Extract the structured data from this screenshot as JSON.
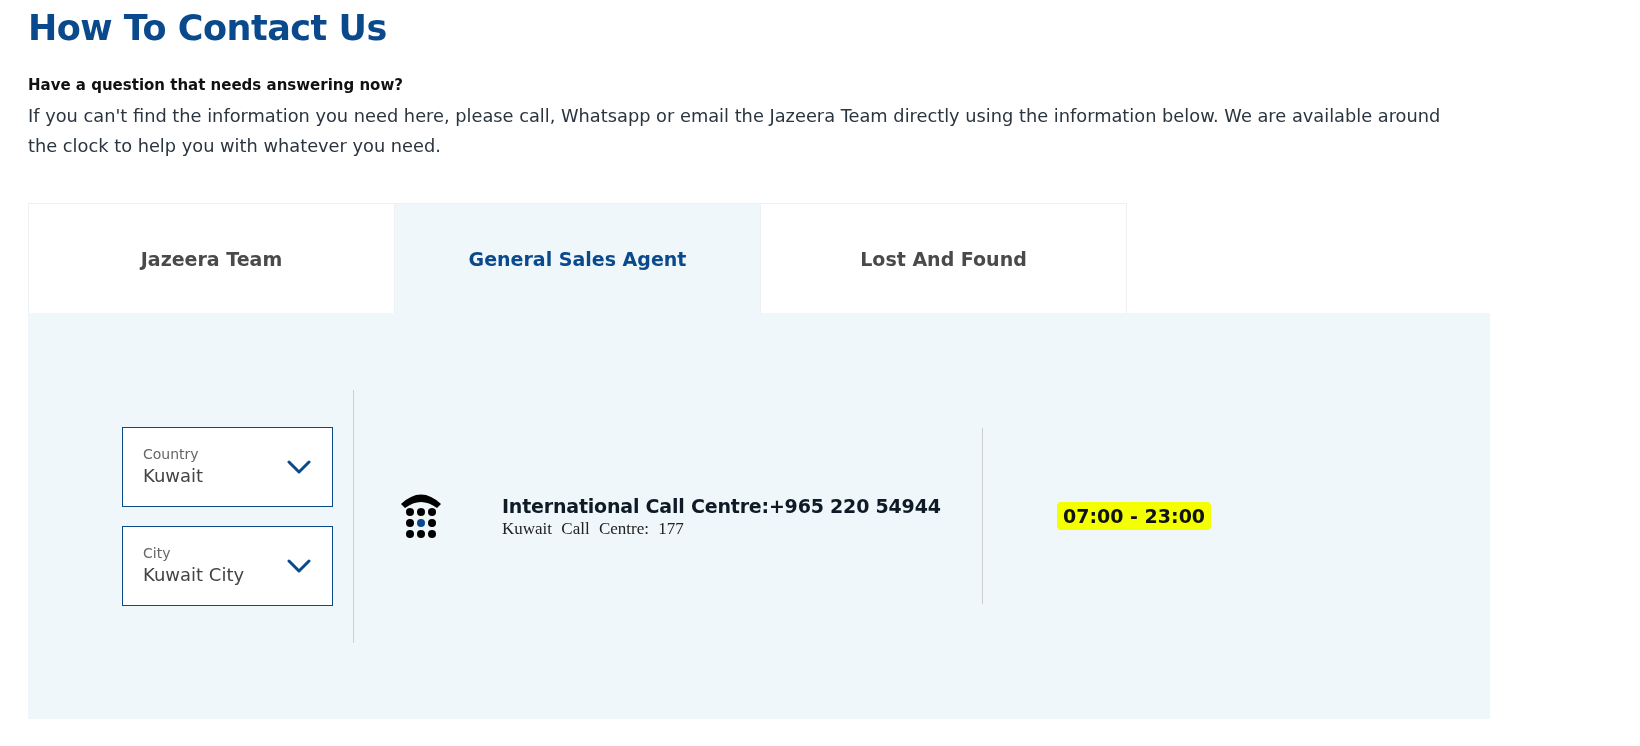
{
  "page": {
    "title": "How To Contact Us",
    "subtitle": "Have a question that needs answering now?",
    "intro": "If you can't find the information you need here, please call, Whatsapp or email the Jazeera Team directly using the information below. We are available around the clock to help you with whatever you need."
  },
  "tabs": [
    {
      "label": "Jazeera Team",
      "selected": false
    },
    {
      "label": "General Sales Agent",
      "selected": true
    },
    {
      "label": "Lost And Found",
      "selected": false
    }
  ],
  "filters": [
    {
      "label": "Country",
      "value": "Kuwait"
    },
    {
      "label": "City",
      "value": "Kuwait City"
    }
  ],
  "contact": {
    "primary": "International Call Centre:+965 220 54944",
    "secondary": "Kuwait Call Centre: 177",
    "hours": "07:00 - 23:00",
    "hours_highlighted": true
  }
}
